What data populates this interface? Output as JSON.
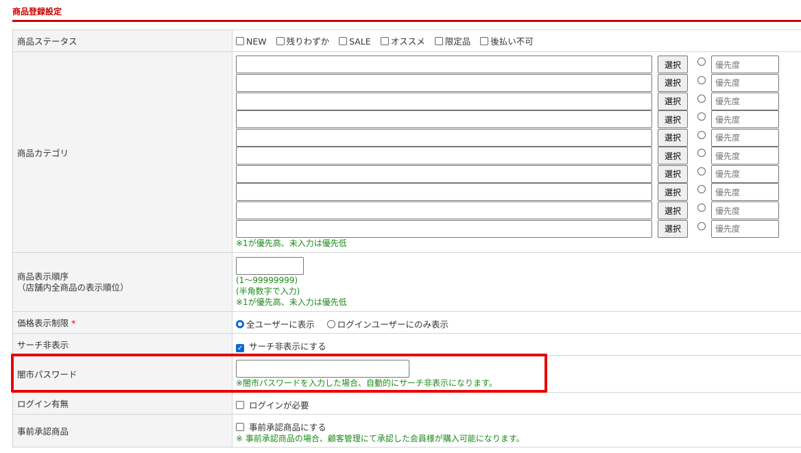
{
  "title": "商品登録設定",
  "rows": {
    "status": {
      "label": "商品ステータス",
      "options": [
        "NEW",
        "残りわずか",
        "SALE",
        "オススメ",
        "限定品",
        "後払い不可"
      ]
    },
    "category": {
      "label": "商品カテゴリ",
      "select_label": "選択",
      "priority_placeholder": "優先度",
      "count": 10,
      "note": "※1が優先高、未入力は優先低"
    },
    "order": {
      "label": "商品表示順序",
      "sublabel": "（店舗内全商品の表示順位）",
      "value": "",
      "notes": [
        "(1～99999999)",
        "(半角数字で入力)",
        "※1が優先高、未入力は優先低"
      ]
    },
    "price": {
      "label": "価格表示制限",
      "required": "*",
      "options": [
        "全ユーザーに表示",
        "ログインユーザーにのみ表示"
      ],
      "selected": 0
    },
    "search": {
      "label": "サーチ非表示",
      "option": "サーチ非表示にする",
      "checked": true
    },
    "password": {
      "label": "闇市パスワード",
      "value": "",
      "note": "※闇市パスワードを入力した場合、自動的にサーチ非表示になります。"
    },
    "login": {
      "label": "ログイン有無",
      "option": "ログインが必要",
      "checked": false
    },
    "preapproval": {
      "label": "事前承認商品",
      "option": "事前承認商品にする",
      "checked": false,
      "note": "※ 事前承認商品の場合、顧客管理にて承認した会員様が購入可能になります。"
    }
  },
  "colors": {
    "accent": "#cc0000",
    "note": "#1a8a1a",
    "highlight": "#e80000"
  }
}
